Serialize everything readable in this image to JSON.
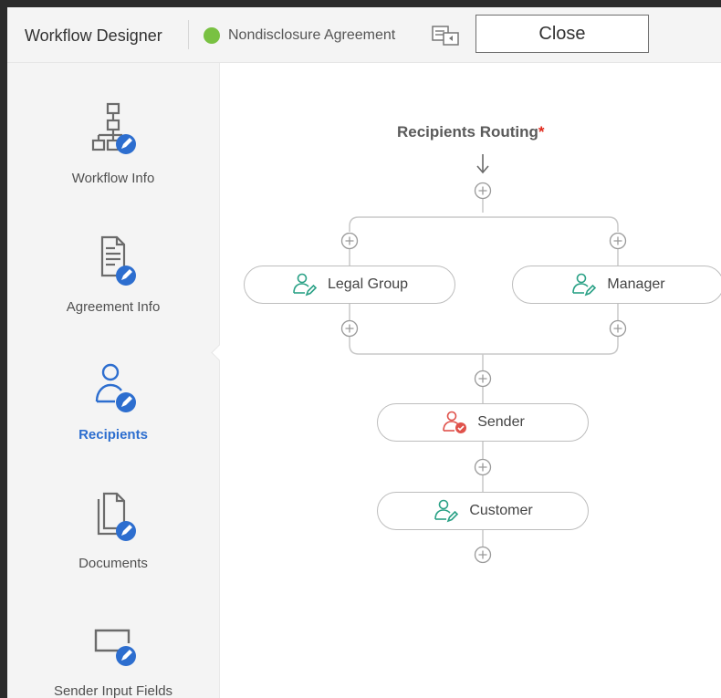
{
  "header": {
    "app_title": "Workflow Designer",
    "document_name": "Nondisclosure Agreement",
    "status_color": "#79c142",
    "close_label": "Close"
  },
  "sidebar": {
    "items": [
      {
        "label": "Workflow Info",
        "icon": "workflow-hierarchy-icon",
        "active": false
      },
      {
        "label": "Agreement Info",
        "icon": "agreement-document-icon",
        "active": false
      },
      {
        "label": "Recipients",
        "icon": "recipient-person-icon",
        "active": true
      },
      {
        "label": "Documents",
        "icon": "documents-icon",
        "active": false
      },
      {
        "label": "Sender Input Fields",
        "icon": "input-field-icon",
        "active": false
      }
    ],
    "accent_color": "#2d6ecf"
  },
  "routing": {
    "title": "Recipients Routing",
    "required_mark": "*",
    "nodes": {
      "legal_group": "Legal Group",
      "manager": "Manager",
      "sender": "Sender",
      "customer": "Customer"
    },
    "signer_color": "#2aa186",
    "sender_color": "#e0524b"
  }
}
